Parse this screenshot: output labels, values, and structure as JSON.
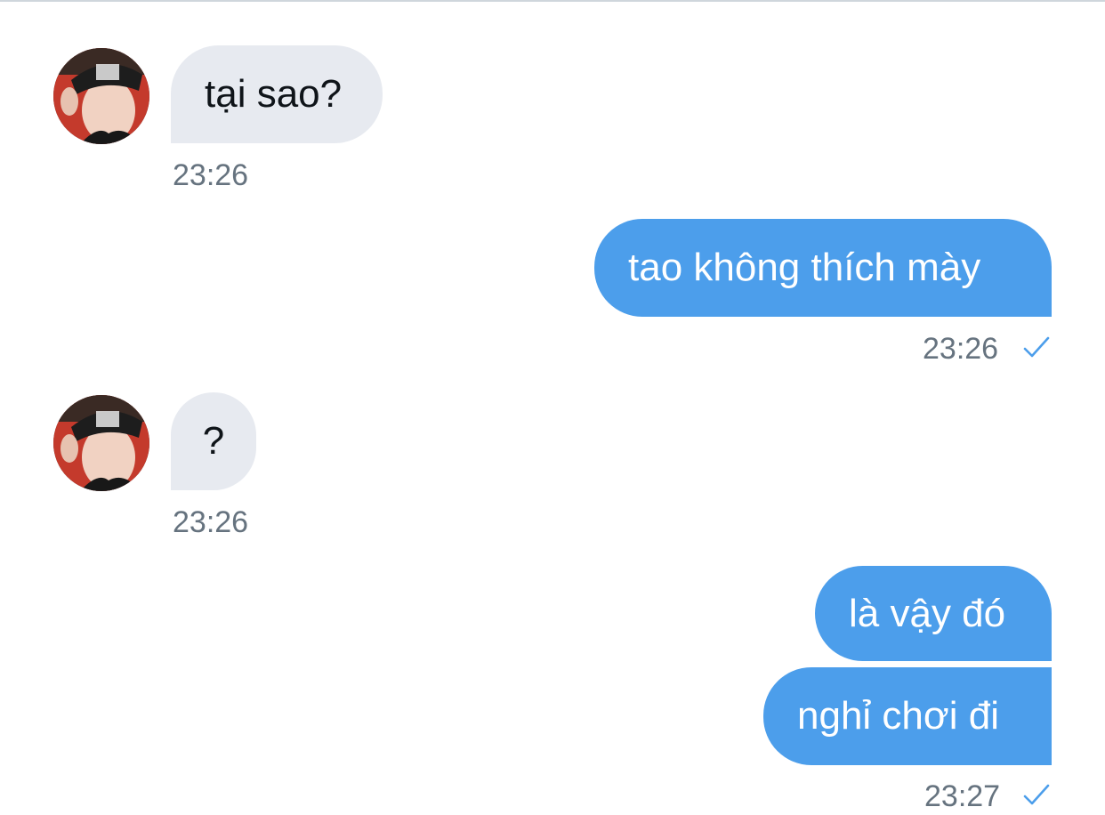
{
  "conversation": {
    "messages": [
      {
        "direction": "received",
        "text": "tại sao?",
        "time": "23:26"
      },
      {
        "direction": "sent",
        "text": "tao không thích mày",
        "time": "23:26"
      },
      {
        "direction": "received",
        "text": "?",
        "time": "23:26"
      },
      {
        "direction": "sent",
        "text": "là vậy đó"
      },
      {
        "direction": "sent",
        "text": "nghỉ chơi đi",
        "time": "23:27"
      }
    ]
  },
  "colors": {
    "sent_bubble": "#4c9eeb",
    "received_bubble": "#e7eaf0",
    "timestamp": "#66737f",
    "check": "#4c9eeb"
  },
  "icons": {
    "read_receipt": "checkmark-icon",
    "avatar": "contact-avatar"
  }
}
